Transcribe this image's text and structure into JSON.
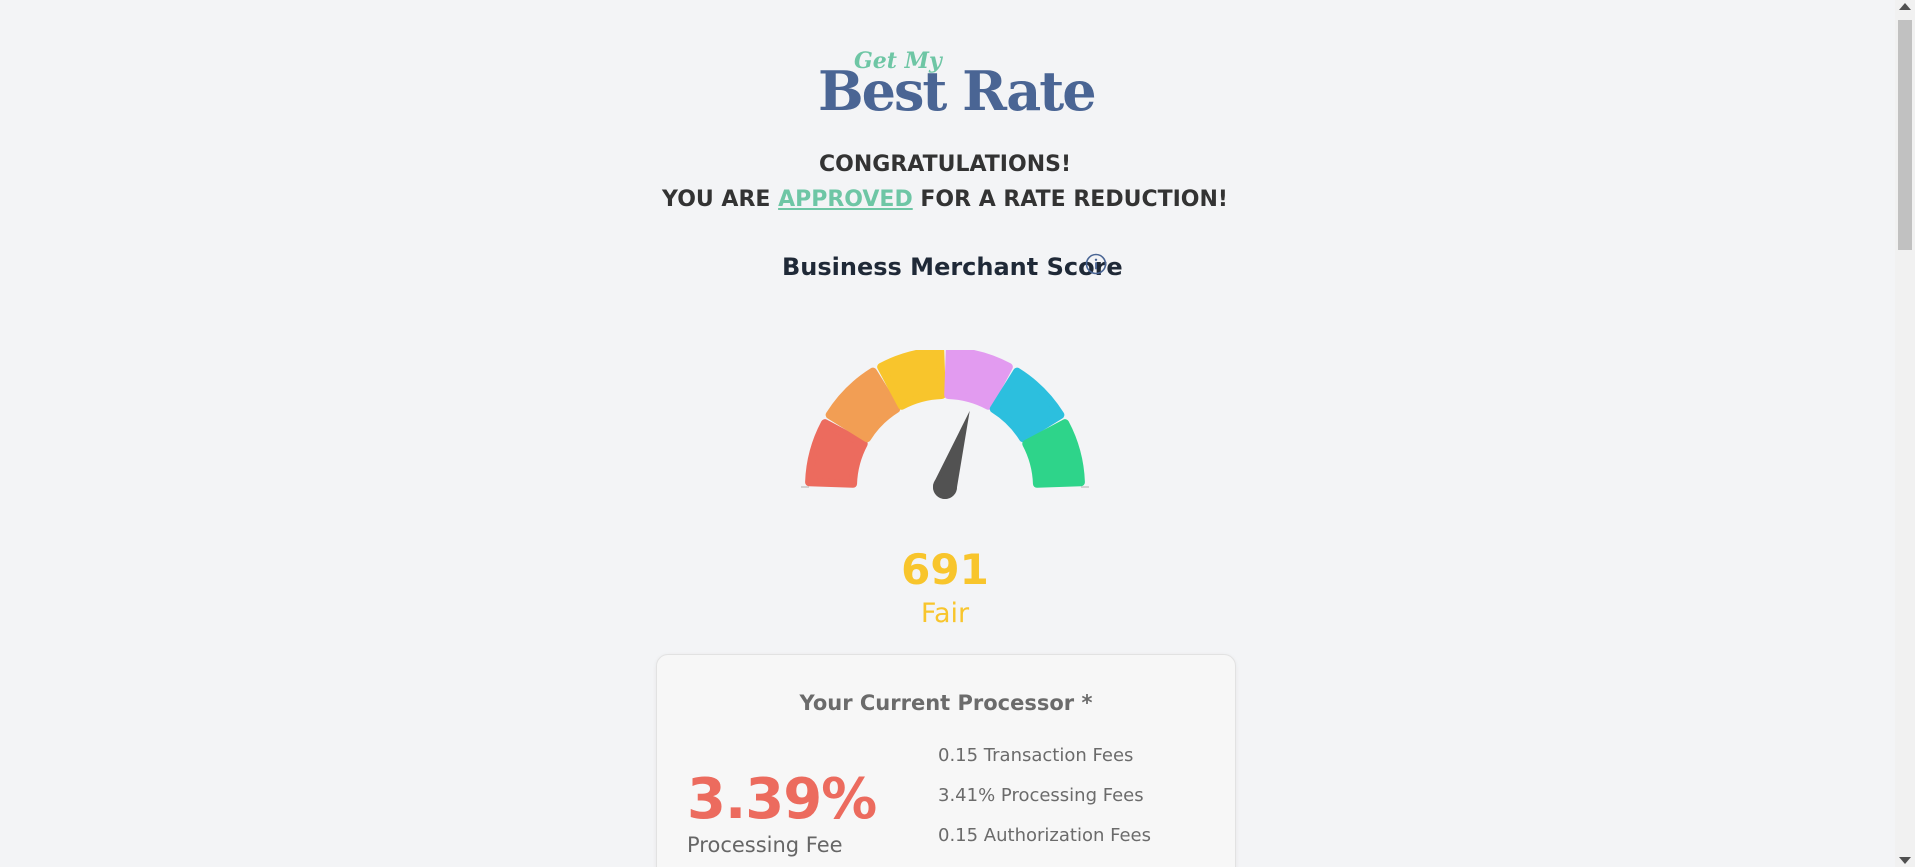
{
  "logo": {
    "small_text": "Get My",
    "big_text": "Best Rate"
  },
  "headline": {
    "line1": "CONGRATULATIONS!",
    "line2_prefix": "YOU ARE ",
    "line2_highlight": "APPROVED",
    "line2_suffix": " FOR A RATE REDUCTION!"
  },
  "score": {
    "title": "Business Merchant Score",
    "info_icon": "info-circle-icon",
    "value": "691",
    "label": "Fair",
    "gauge_segments": [
      "#ec6b5e",
      "#f29e54",
      "#f8c52c",
      "#e29bf0",
      "#2cbfde",
      "#2ed48a"
    ],
    "needle_fraction": 0.6
  },
  "processor": {
    "title": "Your Current Processor *",
    "rate": "3.39%",
    "rate_caption": "Processing Fee",
    "fees": [
      "0.15 Transaction Fees",
      "3.41% Processing Fees",
      "0.15 Authorization Fees"
    ]
  },
  "colors": {
    "accent_green": "#6ec6a5",
    "logo_blue": "#4a6594",
    "score_yellow": "#f8c52c",
    "rate_red": "#ec6b5e"
  }
}
